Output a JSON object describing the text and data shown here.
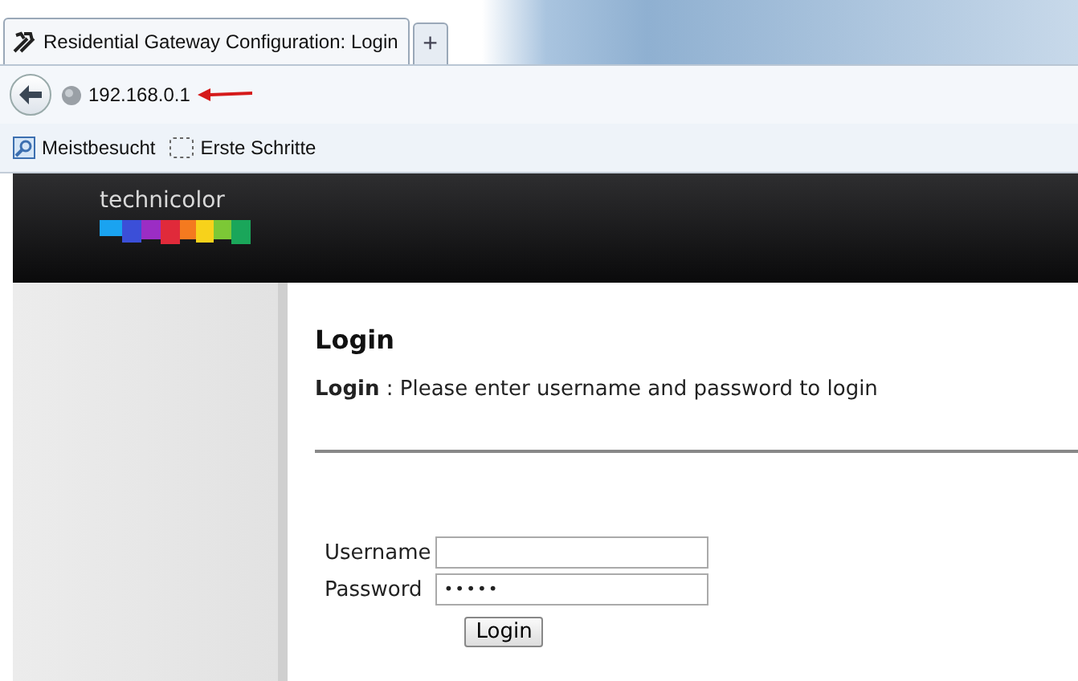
{
  "browser": {
    "tabs": [
      {
        "title": "Residential Gateway Configuration: Login",
        "selected": true
      }
    ],
    "new_tab": "+",
    "url": "192.168.0.1",
    "bookmarks": [
      {
        "label": "Meistbesucht",
        "kind": "search"
      },
      {
        "label": "Erste Schritte",
        "kind": "blank"
      }
    ]
  },
  "header": {
    "logo": "technicolor"
  },
  "login": {
    "title": "Login",
    "intro_label": "Login",
    "intro_sep": ":",
    "intro_text": "Please enter username and password to login",
    "fields": [
      {
        "label": "Username"
      },
      {
        "label": "Password",
        "value": "•••••"
      }
    ],
    "button": "Login"
  }
}
